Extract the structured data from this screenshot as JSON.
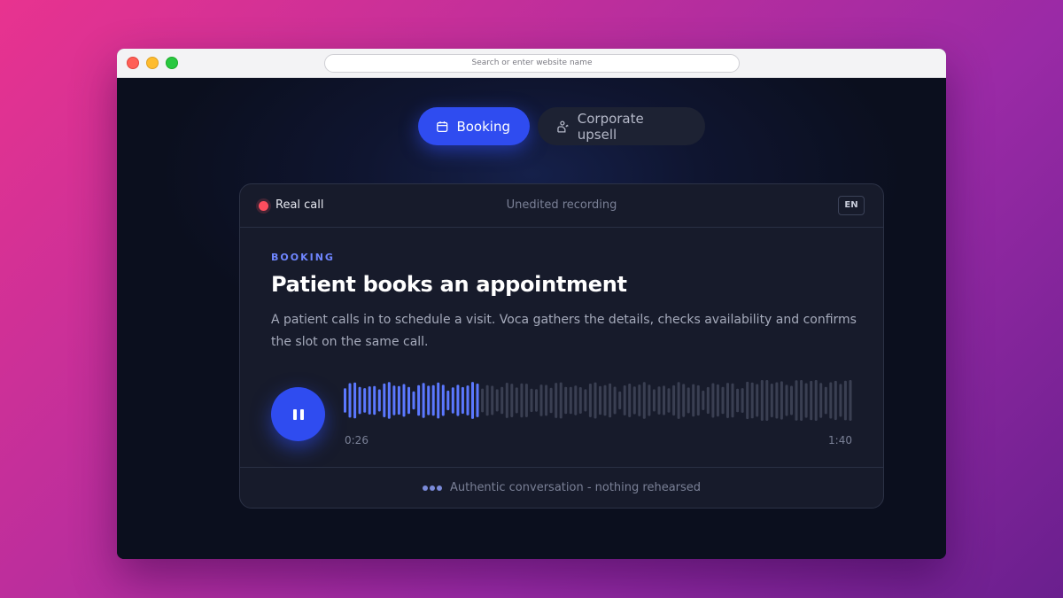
{
  "browser": {
    "address_placeholder": "Search or enter website name"
  },
  "tabs": [
    {
      "label": "Booking",
      "icon": "calendar-icon",
      "active": true
    },
    {
      "label": "Corporate upsell",
      "icon": "person-upsell-icon",
      "active": false
    }
  ],
  "card": {
    "status_label": "Real call",
    "recording_label": "Unedited recording",
    "language": "EN",
    "eyebrow": "BOOKING",
    "title": "Patient books an appointment",
    "description": "A patient calls in to schedule a visit. Voca gathers the details, checks availability and confirms the slot on the same call.",
    "player": {
      "state": "playing",
      "current_time": "0:26",
      "total_time": "1:40",
      "progress": 0.26
    },
    "footer_text": "Authentic conversation - nothing rehearsed"
  },
  "colors": {
    "accent": "#2f4cf0",
    "live": "#ff4d5e",
    "played_wave": "#5b78ff",
    "unplayed_wave": "#3a3f52"
  }
}
